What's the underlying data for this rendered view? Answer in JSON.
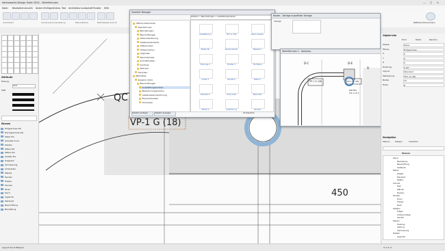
{
  "app": {
    "title": "Vectorworks Design Suite 2024 - Steinfeld.vwx",
    "window_controls": [
      "—",
      "□",
      "✕"
    ]
  },
  "menu": {
    "items": [
      "Datei",
      "Bearbeiten",
      "Ansicht",
      "Ändern",
      "Einfügen",
      "Extras",
      "Text",
      "Architektur",
      "Landschaft",
      "Fenster",
      "Hilfe"
    ]
  },
  "ribbon": {
    "group_labels": [
      "Ansichtsart",
      "Gemeinsame Darstellung",
      "Ebene/Klasse",
      "Nächstbeste Ansicht"
    ],
    "username": "Matthias Zimmermann"
  },
  "left_panel": {
    "attributes_title": "Attribute",
    "fill_label": "Füllung",
    "pen_label": "Stift",
    "fill_value": "Solid",
    "layers_title": "Ebenen",
    "layers": [
      "Erdgeschoss EG",
      "Dachgeschoss DG",
      "Keller KG",
      "Schnitte Fund",
      "Details",
      "Möbel EG",
      "Möbel OG",
      "Sanitär EG",
      "Tragwerk",
      "Vermessung",
      "Achsraster",
      "Wände",
      "Decken",
      "Treppe",
      "Fenster",
      "Türen",
      "Dach",
      "Legende",
      "Plankopf",
      "Beschriftung",
      "Bemaßung"
    ],
    "footer": "Layout durch Ebenen"
  },
  "canvas": {
    "label_qc": "QC",
    "label_vp": "VP-1 G (18)",
    "dimension": "450"
  },
  "resource_dialog": {
    "title": "Zubehör Manager",
    "path": "Zubehör > Beschriftungen > Ausstattungsmarken",
    "tree": [
      "Offene Dokumente",
      "Steinfeld.vwx",
      "Bemaßungen",
      "Beschriftungen",
      "Datenmarkierung",
      "Gebäudeelemente",
      "Gitterachsen",
      "Höhenmarken",
      "Legenden",
      "Raumstempel",
      "Schnittmarken",
      "Symbole",
      "Texturen",
      "Favoriten",
      "Bibliothek",
      "Zubehör 2024",
      "Beschriftungen",
      "Ausstattungsmarken",
      "Bezeichnungsmarken",
      "Gebäudekennzeichnung",
      "Elementmarken",
      "Türmarken"
    ],
    "thumbs": [
      "Ausstattung 1",
      "VP-1 G (18)",
      "Raum Aussen",
      "Stütze Nr.",
      "Raumnummer",
      "Bauteil A",
      "Planungs 1",
      "Fenster 1",
      "Tür Marke",
      "Achse 1",
      "Schnitt A",
      "Detail 1",
      "Element 1",
      "Höhe 0.00",
      "Ebene EG",
      "Marke 2",
      "Ausführung",
      "Verweis"
    ],
    "status": "18 Zubehöre",
    "buttons": [
      "Zubehör einfügen",
      "Zubehör anzeigen"
    ]
  },
  "small_dialog": {
    "title": "Einstellungen",
    "header": "Raster - Vorlage auswählen Vorlage",
    "field": "Vorlage"
  },
  "preview_dialog": {
    "title": "Steinfeld.vwx 1 - Vorschau",
    "labels": [
      "D-C",
      "D-E",
      "D",
      "VP-1 G (18)",
      "VP-1 G (18)",
      "FTR-2",
      "E10",
      "D14",
      "DW-F81",
      "0.6 x 11.4"
    ]
  },
  "right_panel": {
    "title": "Objekt-Info",
    "tabs": [
      "Form",
      "Daten",
      "Rendern"
    ],
    "properties": [
      {
        "label": "Klasse",
        "value": "Keine"
      },
      {
        "label": "Ebene",
        "value": "Erdgeschoss"
      },
      {
        "label": "X",
        "value": "0"
      },
      {
        "label": "Y",
        "value": "0"
      },
      {
        "label": "Z",
        "value": "0"
      },
      {
        "label": "Drehung",
        "value": "0.00°"
      },
      {
        "label": "Layout",
        "value": "Standard"
      },
      {
        "label": "Markierung",
        "value": "VP-1 G (18)"
      },
      {
        "label": "Breite",
        "value": "15"
      },
      {
        "label": "Höhe",
        "value": "8"
      }
    ],
    "nav_title": "Navigation",
    "nav_tabs": [
      "Ebenen",
      "Klassen",
      "Ansichten"
    ],
    "class_header": "Klassen",
    "classes": [
      "Keine",
      "Bemaßung",
      "Beschriftung",
      "Gebäude",
      "Möbel",
      "Objekt",
      "Plankopf",
      "Raster",
      "Schnitt",
      "Text",
      "Wände",
      "Decken",
      "Fenster",
      "Türen",
      "Treppe",
      "Dach",
      "Stützen",
      "Träger",
      "Aussenanlage",
      "Sanitär",
      "Elektro",
      "Heizung",
      "Lüftung",
      "Vermessung",
      "Details",
      "Legende"
    ]
  },
  "status_bar": {
    "left": "Layout durch Ebenen",
    "right": "X: 0   Y: 0"
  }
}
